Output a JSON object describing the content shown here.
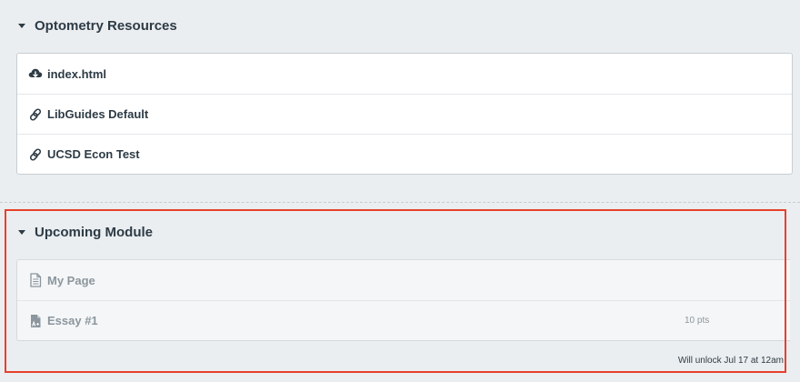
{
  "modules": [
    {
      "title": "Optometry Resources",
      "items": [
        {
          "title": "index.html",
          "icon": "cloud-download-icon"
        },
        {
          "title": "LibGuides Default",
          "icon": "link-icon"
        },
        {
          "title": "UCSD Econ Test",
          "icon": "link-icon"
        }
      ]
    },
    {
      "title": "Upcoming Module",
      "items": [
        {
          "title": "My Page",
          "icon": "page-icon",
          "points": ""
        },
        {
          "title": "Essay #1",
          "icon": "assignment-icon",
          "points": "10 pts"
        }
      ],
      "unlock_text": "Will unlock Jul 17 at 12am"
    }
  ],
  "colors": {
    "background": "#ebeef1",
    "text": "#2d3b45",
    "muted_text": "#8b969e",
    "highlight": "#e8402a"
  }
}
